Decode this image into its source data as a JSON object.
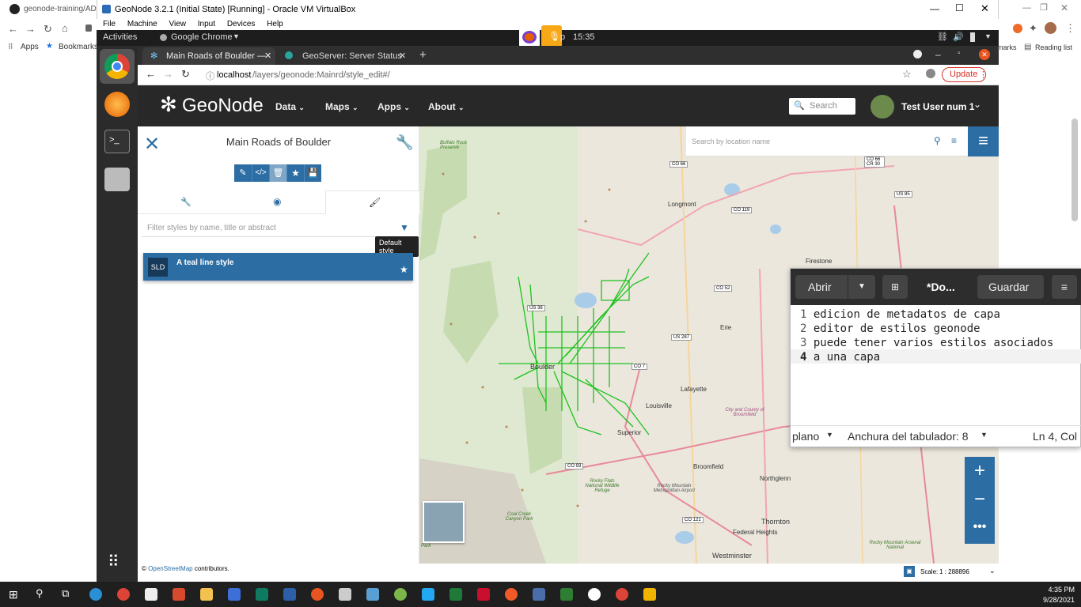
{
  "host": {
    "tab_title": "geonode-training/ADDI",
    "bookmarks": [
      "Apps",
      "Bookmarks"
    ],
    "right_bm": "marks",
    "reading_list": "Reading list"
  },
  "vbox": {
    "title": "GeoNode 3.2.1 (Initial State) [Running] - Oracle VM VirtualBox",
    "menu": [
      "File",
      "Machine",
      "View",
      "Input",
      "Devices",
      "Help"
    ]
  },
  "ubuntu": {
    "activities": "Activities",
    "app": "Google Chrome",
    "time": "15:35",
    "time_prefix": "p"
  },
  "chrome": {
    "tabs": [
      {
        "label": "Main Roads of Boulder —",
        "active": true
      },
      {
        "label": "GeoServer: Server Status",
        "active": false
      }
    ],
    "url_host": "localhost",
    "url_path": "/layers/geonode:Mainrd/style_edit#/",
    "update_label": "Update"
  },
  "geonode": {
    "brand": "GeoNode",
    "menus": [
      "Data",
      "Maps",
      "Apps",
      "About"
    ],
    "search_placeholder": "Search",
    "user": "Test User num 1"
  },
  "panel": {
    "title": "Main Roads of Boulder",
    "filter_placeholder": "Filter styles by name, title or abstract",
    "tooltip": "Default style",
    "style_badge": "SLD",
    "style_name": "A teal line style"
  },
  "map": {
    "location_placeholder": "Search by location name",
    "labels": [
      "Longmont",
      "Firestone",
      "Erie",
      "Lafayette",
      "Louisville",
      "Boulder",
      "Superior",
      "Broomfield",
      "Northglenn",
      "Thornton",
      "Federal Heights",
      "Westminster",
      "Buffalo Rock Preserve",
      "Rocky Flats National Wildlife Refuge",
      "Rocky Mountain Metropolitan Airport",
      "Rocky Mountain Arsenal National",
      "Coal Creek Canyon Park",
      "City and County of Broomfield",
      "Park"
    ],
    "shields": [
      "CO 66",
      "CO 119",
      "CO 52",
      "US 287",
      "US 36",
      "CO 7",
      "CO 93",
      "CO 121",
      "US 85",
      "CO 66 CR 30"
    ],
    "scale_label": "Scale:",
    "scale_value": "1 : 288896",
    "attribution_prefix": "©",
    "attribution_link": "OpenStreetMap",
    "attribution_suffix": "contributors."
  },
  "gedit": {
    "open": "Abrir",
    "title": "*Do...",
    "save": "Guardar",
    "lines": [
      {
        "n": "1",
        "text": "edicion de metadatos de capa"
      },
      {
        "n": "2",
        "text": "editor de estilos geonode"
      },
      {
        "n": "3",
        "text": "puede tener varios estilos asociados"
      },
      {
        "n": "4",
        "text": "a una capa"
      }
    ],
    "status_mode": "plano",
    "status_tab": "Anchura del tabulador: 8",
    "status_pos": "Ln 4, Col"
  },
  "taskbar": {
    "time": "4:35 PM",
    "date": "9/28/2021"
  },
  "colors": {
    "accent": "#2c6da3",
    "header": "#282828",
    "roads": "#1ec21e"
  }
}
